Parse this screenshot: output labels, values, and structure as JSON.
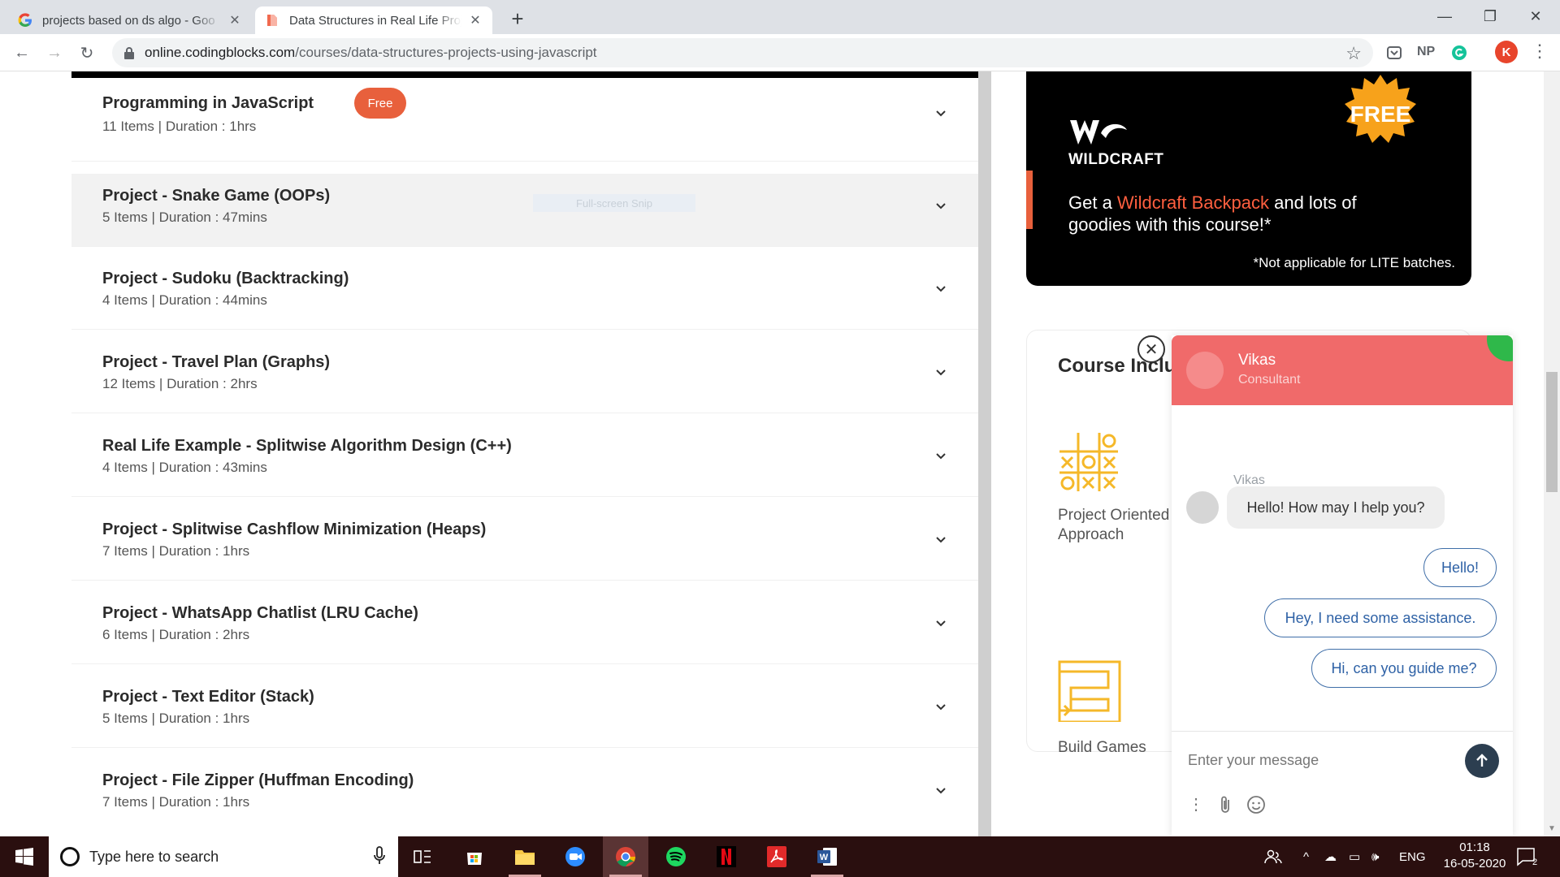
{
  "browser": {
    "tabs": [
      {
        "title": "projects based on ds algo - Goo",
        "favicon": "google-g"
      },
      {
        "title": "Data Structures in Real Life Proje",
        "favicon": "codingblocks"
      }
    ],
    "url_host": "online.codingblocks.com",
    "url_path": "/courses/data-structures-projects-using-javascript",
    "extensions": [
      "NP"
    ],
    "profile_initial": "K"
  },
  "course_sections": [
    {
      "title": "Programming in JavaScript",
      "items": "11 Items",
      "duration": "Duration : 1hrs",
      "badge": "Free"
    },
    {
      "title": "Project - Snake Game (OOPs)",
      "items": "5 Items",
      "duration": "Duration : 47mins",
      "overlay": "Full-screen Snip"
    },
    {
      "title": "Project - Sudoku (Backtracking)",
      "items": "4 Items",
      "duration": "Duration : 44mins"
    },
    {
      "title": "Project - Travel Plan (Graphs)",
      "items": "12 Items",
      "duration": "Duration : 2hrs"
    },
    {
      "title": "Real Life Example - Splitwise Algorithm Design (C++)",
      "items": "4 Items",
      "duration": "Duration : 43mins"
    },
    {
      "title": "Project - Splitwise Cashflow Minimization (Heaps)",
      "items": "7 Items",
      "duration": "Duration : 1hrs"
    },
    {
      "title": "Project - WhatsApp Chatlist (LRU Cache)",
      "items": "6 Items",
      "duration": "Duration : 2hrs"
    },
    {
      "title": "Project - Text Editor (Stack)",
      "items": "5 Items",
      "duration": "Duration : 1hrs"
    },
    {
      "title": "Project - File Zipper (Huffman Encoding)",
      "items": "7 Items",
      "duration": "Duration : 1hrs"
    }
  ],
  "promo": {
    "brand": "WILDCRAFT",
    "badge": "FREE",
    "headline_pre": "Get a ",
    "headline_highlight": "Wildcraft Backpack",
    "headline_post": " and lots of goodies with this course!*",
    "note": "*Not applicable for LITE batches."
  },
  "course_includes": {
    "title": "Course Inclu",
    "items": [
      {
        "line1": "Project Oriented",
        "line2": "Approach",
        "icon": "tic-tac-toe-icon"
      },
      {
        "line1": "Build Games",
        "line2": "",
        "icon": "maze-icon"
      }
    ]
  },
  "chat": {
    "agent_name": "Vikas",
    "agent_role": "Consultant",
    "agent_label": "Vikas",
    "agent_message": "Hello! How may I help you?",
    "quick_replies": [
      "Hello!",
      "Hey, I need some assistance.",
      "Hi, can you guide me?"
    ],
    "input_placeholder": "Enter your message"
  },
  "taskbar": {
    "search_placeholder": "Type here to search",
    "language": "ENG",
    "time": "01:18",
    "date": "16-05-2020",
    "notifications": "2"
  },
  "colors": {
    "accent_orange": "#e8603c",
    "chat_header": "#f06a6a",
    "taskbar": "#2a0f0f",
    "link_blue": "#2f62a6"
  }
}
